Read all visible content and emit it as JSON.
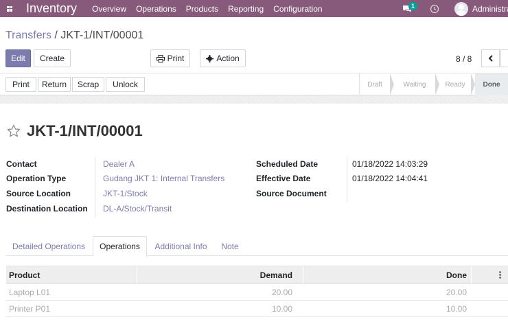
{
  "navbar": {
    "app_name": "Inventory",
    "menu": [
      "Overview",
      "Operations",
      "Products",
      "Reporting",
      "Configuration"
    ],
    "message_count": "1",
    "user_name": "Administrator"
  },
  "breadcrumb": {
    "parent": "Transfers",
    "separator": " / ",
    "current": "JKT-1/INT/00001"
  },
  "toolbar": {
    "edit": "Edit",
    "create": "Create",
    "print": "Print",
    "action": "Action"
  },
  "pager": {
    "value": "8 / 8"
  },
  "status_buttons": {
    "print": "Print",
    "return": "Return",
    "scrap": "Scrap",
    "unlock": "Unlock"
  },
  "stages": {
    "draft": "Draft",
    "waiting": "Waiting",
    "ready": "Ready",
    "done": "Done",
    "current": "Done"
  },
  "record": {
    "name": "JKT-1/INT/00001"
  },
  "fields": {
    "contact_label": "Contact",
    "contact": "Dealer A",
    "operation_type_label": "Operation Type",
    "operation_type": "Gudang JKT 1: Internal Transfers",
    "source_location_label": "Source Location",
    "source_location": "JKT-1/Stock",
    "destination_location_label": "Destination Location",
    "destination_location": "DL-A/Stock/Transit",
    "scheduled_date_label": "Scheduled Date",
    "scheduled_date": "01/18/2022 14:03:29",
    "effective_date_label": "Effective Date",
    "effective_date": "01/18/2022 14:04:41",
    "source_document_label": "Source Document",
    "source_document": ""
  },
  "tabs": [
    "Detailed Operations",
    "Operations",
    "Additional Info",
    "Note"
  ],
  "active_tab": "Operations",
  "table": {
    "headers": {
      "product": "Product",
      "demand": "Demand",
      "done": "Done"
    },
    "rows": [
      {
        "product": "Laptop L01",
        "demand": "20.00",
        "done": "20.00"
      },
      {
        "product": "Printer P01",
        "demand": "10.00",
        "done": "10.00"
      }
    ]
  },
  "colors": {
    "navbar": "#875a7b",
    "primary": "#7c7bad",
    "link": "#7c7bad",
    "badge": "#00a09d"
  }
}
